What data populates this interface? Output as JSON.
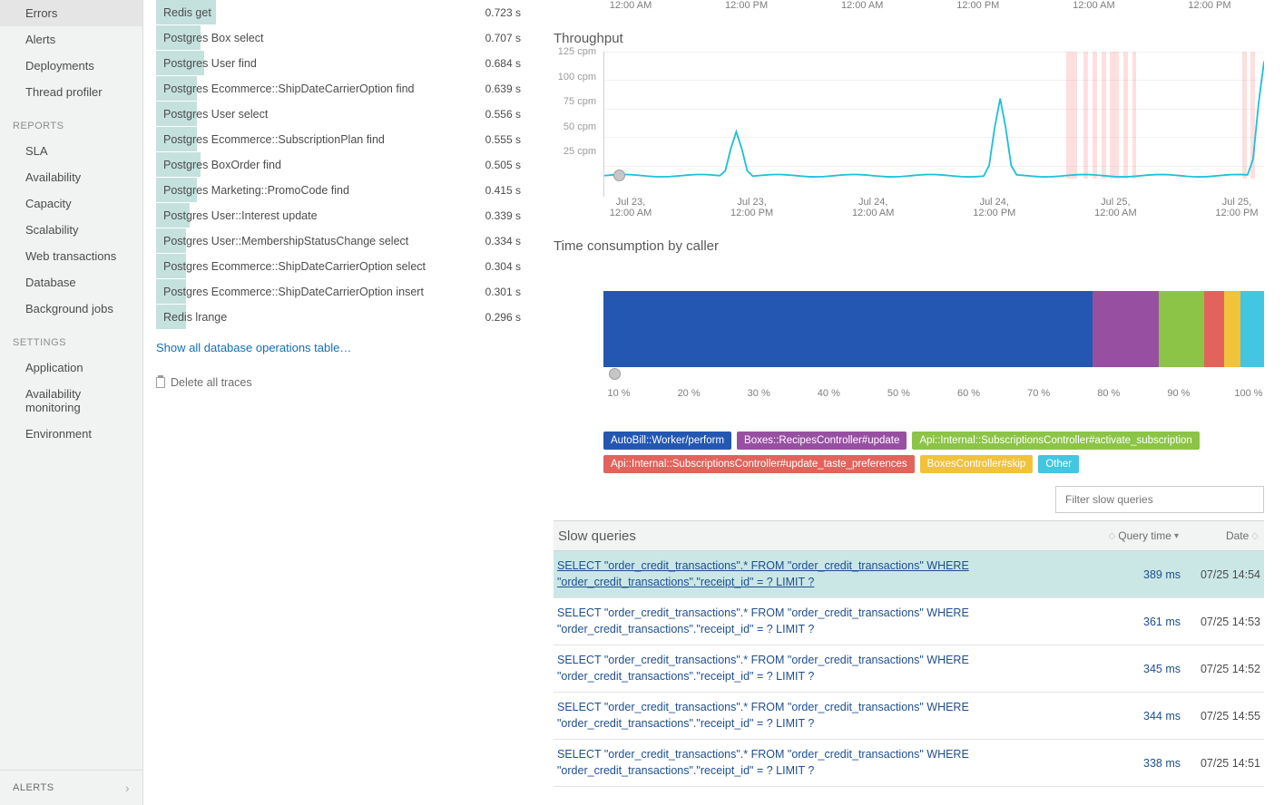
{
  "sidebar": {
    "groups": [
      {
        "heading": null,
        "items": [
          "Errors",
          "Alerts",
          "Deployments",
          "Thread profiler"
        ]
      },
      {
        "heading": "REPORTS",
        "items": [
          "SLA",
          "Availability",
          "Capacity",
          "Scalability",
          "Web transactions",
          "Database",
          "Background jobs"
        ]
      },
      {
        "heading": "SETTINGS",
        "items": [
          "Application",
          "Availability monitoring",
          "Environment"
        ]
      }
    ],
    "alerts_footer": "ALERTS"
  },
  "operations": [
    {
      "name": "Redis get",
      "val": "0.723 s",
      "pct": 16
    },
    {
      "name": "Postgres Box select",
      "val": "0.707 s",
      "pct": 12
    },
    {
      "name": "Postgres User find",
      "val": "0.684 s",
      "pct": 13
    },
    {
      "name": "Postgres Ecommerce::ShipDateCarrierOption find",
      "val": "0.639 s",
      "pct": 11
    },
    {
      "name": "Postgres User select",
      "val": "0.556 s",
      "pct": 11
    },
    {
      "name": "Postgres Ecommerce::SubscriptionPlan find",
      "val": "0.555 s",
      "pct": 11
    },
    {
      "name": "Postgres BoxOrder find",
      "val": "0.505 s",
      "pct": 12
    },
    {
      "name": "Postgres Marketing::PromoCode find",
      "val": "0.415 s",
      "pct": 11
    },
    {
      "name": "Postgres User::Interest update",
      "val": "0.339 s",
      "pct": 9
    },
    {
      "name": "Postgres User::MembershipStatusChange select",
      "val": "0.334 s",
      "pct": 8
    },
    {
      "name": "Postgres Ecommerce::ShipDateCarrierOption select",
      "val": "0.304 s",
      "pct": 8
    },
    {
      "name": "Postgres Ecommerce::ShipDateCarrierOption insert",
      "val": "0.301 s",
      "pct": 8
    },
    {
      "name": "Redis lrange",
      "val": "0.296 s",
      "pct": 8
    }
  ],
  "show_all_label": "Show all database operations table…",
  "delete_traces_label": "Delete all traces",
  "top_xticks": [
    "12:00 AM",
    "12:00 PM",
    "12:00 AM",
    "12:00 PM",
    "12:00 AM",
    "12:00 PM"
  ],
  "throughput": {
    "title": "Throughput",
    "yticks": [
      "125 cpm",
      "100 cpm",
      "75 cpm",
      "50 cpm",
      "25 cpm"
    ],
    "xticks": [
      "Jul 23, 12:00 AM",
      "Jul 23, 12:00 PM",
      "Jul 24, 12:00 AM",
      "Jul 24, 12:00 PM",
      "Jul 25, 12:00 AM",
      "Jul 25, 12:00 PM"
    ]
  },
  "chart_data": {
    "throughput": {
      "type": "line",
      "ylim": [
        0,
        130
      ],
      "ylabel": "cpm",
      "x_hours": [
        0,
        12,
        24,
        36,
        48,
        60
      ],
      "series": [
        {
          "name": "throughput",
          "baseline": 3,
          "spikes": [
            {
              "x": 12,
              "peak": 48
            },
            {
              "x": 36,
              "peak": 82
            },
            {
              "x": 60,
              "peak": 120
            }
          ]
        }
      ],
      "alert_bands_hours": [
        [
          42,
          43
        ],
        [
          43.6,
          44
        ],
        [
          44.4,
          44.8
        ],
        [
          45.2,
          45.6
        ],
        [
          46,
          46.8
        ],
        [
          47.2,
          47.6
        ],
        [
          48,
          48.4
        ],
        [
          58,
          58.4
        ],
        [
          58.8,
          59.2
        ],
        [
          63.4,
          64
        ],
        [
          64.5,
          65.2
        ],
        [
          66,
          66.4
        ]
      ]
    },
    "time_consumption": {
      "type": "stacked-bar-100pct",
      "xlabel": "%",
      "xlim": [
        0,
        100
      ],
      "series": [
        {
          "name": "AutoBill::Worker/perform",
          "pct": 74,
          "color": "#2457b2"
        },
        {
          "name": "Boxes::RecipesController#update",
          "pct": 10,
          "color": "#9750a1"
        },
        {
          "name": "Api::Internal::SubscriptionsController#activate_subscription",
          "pct": 7,
          "color": "#8cc447"
        },
        {
          "name": "Api::Internal::SubscriptionsController#update_taste_preferences",
          "pct": 3,
          "color": "#e2635c"
        },
        {
          "name": "BoxesController#skip",
          "pct": 2.5,
          "color": "#f1c23a"
        },
        {
          "name": "Other",
          "pct": 3.5,
          "color": "#42c6e1"
        }
      ]
    }
  },
  "consumption_title": "Time consumption by caller",
  "pct_ticks": [
    "10 %",
    "20 %",
    "30 %",
    "40 %",
    "50 %",
    "60 %",
    "70 %",
    "80 %",
    "90 %",
    "100 %"
  ],
  "legend": [
    {
      "label": "AutoBill::Worker/perform",
      "color": "#2457b2"
    },
    {
      "label": "Boxes::RecipesController#update",
      "color": "#9750a1"
    },
    {
      "label": "Api::Internal::SubscriptionsController#activate_subscription",
      "color": "#8cc447"
    },
    {
      "label": "Api::Internal::SubscriptionsController#update_taste_preferences",
      "color": "#e2635c"
    },
    {
      "label": "BoxesController#skip",
      "color": "#f1c23a"
    },
    {
      "label": "Other",
      "color": "#42c6e1"
    }
  ],
  "filter_placeholder": "Filter slow queries",
  "slow_queries": {
    "title": "Slow queries",
    "columns": {
      "query_time": "Query time",
      "date": "Date"
    },
    "rows": [
      {
        "q": "SELECT \"order_credit_transactions\".* FROM \"order_credit_transactions\" WHERE \"order_credit_transactions\".\"receipt_id\" = ? LIMIT ?",
        "qt": "389 ms",
        "dt": "07/25 14:54"
      },
      {
        "q": "SELECT \"order_credit_transactions\".* FROM \"order_credit_transactions\" WHERE \"order_credit_transactions\".\"receipt_id\" = ? LIMIT ?",
        "qt": "361 ms",
        "dt": "07/25 14:53"
      },
      {
        "q": "SELECT \"order_credit_transactions\".* FROM \"order_credit_transactions\" WHERE \"order_credit_transactions\".\"receipt_id\" = ? LIMIT ?",
        "qt": "345 ms",
        "dt": "07/25 14:52"
      },
      {
        "q": "SELECT \"order_credit_transactions\".* FROM \"order_credit_transactions\" WHERE \"order_credit_transactions\".\"receipt_id\" = ? LIMIT ?",
        "qt": "344 ms",
        "dt": "07/25 14:55"
      },
      {
        "q": "SELECT \"order_credit_transactions\".* FROM \"order_credit_transactions\" WHERE \"order_credit_transactions\".\"receipt_id\" = ? LIMIT ?",
        "qt": "338 ms",
        "dt": "07/25 14:51"
      }
    ]
  }
}
